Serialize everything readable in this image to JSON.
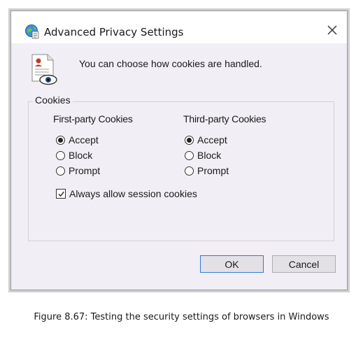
{
  "window": {
    "title": "Advanced Privacy Settings",
    "close_label": "×"
  },
  "intro": "You can choose how cookies are handled.",
  "cookies_group": {
    "legend": "Cookies",
    "first_party": {
      "title": "First-party Cookies",
      "options": [
        "Accept",
        "Block",
        "Prompt"
      ],
      "selected": "Accept"
    },
    "third_party": {
      "title": "Third-party Cookies",
      "options": [
        "Accept",
        "Block",
        "Prompt"
      ],
      "selected": "Accept"
    },
    "session_checkbox": {
      "label": "Always allow session cookies",
      "checked": true
    }
  },
  "buttons": {
    "ok": "OK",
    "cancel": "Cancel"
  },
  "caption": "Figure 8.67: Testing the security settings of browsers in Windows",
  "icons": [
    "privacy-settings-icon",
    "close-icon",
    "document-eye-icon"
  ]
}
